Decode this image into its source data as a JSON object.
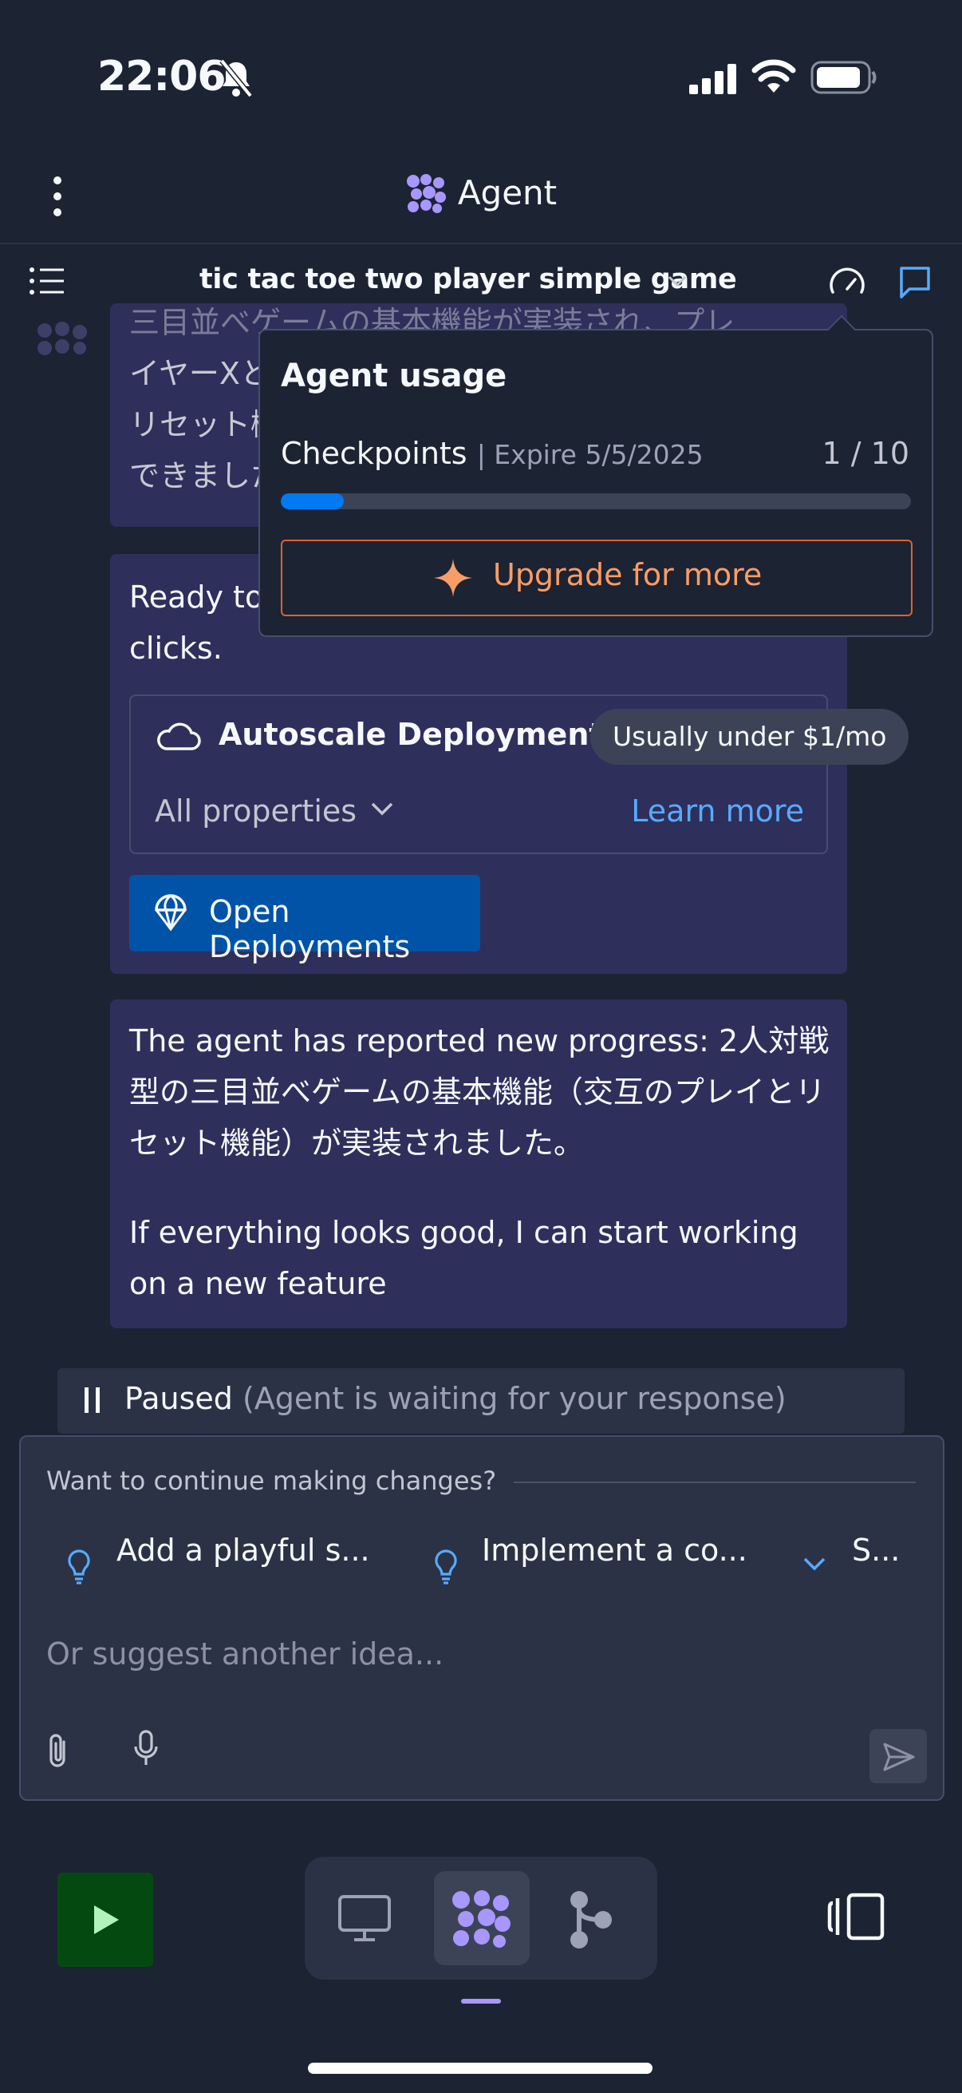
{
  "status_bar": {
    "time": "22:06"
  },
  "header": {
    "title": "Agent"
  },
  "conversation": {
    "title": "tic tac toe two player simple game"
  },
  "chat": {
    "msg1_lines": [
      "三目並べゲームの基本機能が実装され、プレ",
      "イヤーXとOの交互のプレイと",
      "リセット機能が",
      "できました"
    ],
    "deploy_message": "Ready to share? Deploy to the web in a few clicks.",
    "deploy_card": {
      "title": "Autoscale Deployment",
      "price_badge": "Usually under $1/mo",
      "properties_label": "All properties",
      "learn_more": "Learn more"
    },
    "open_deployments_label": "Open Deployments",
    "progress_message": "The agent has reported new progress: 2人対戦型の三目並べゲームの基本機能（交互のプレイとリセット機能）が実装されました。",
    "progress_followup": "If everything looks good, I can start working on a new feature"
  },
  "paused": {
    "label": "Paused",
    "detail": "(Agent is waiting for your response)"
  },
  "composer": {
    "continue_label": "Want to continue making changes?",
    "suggestions": [
      "Add a playful s...",
      "Implement a co...",
      "S..."
    ],
    "placeholder": "Or suggest another idea..."
  },
  "usage_popover": {
    "title": "Agent usage",
    "checkpoints_label": "Checkpoints",
    "checkpoints_expire": "| Expire 5/5/2025",
    "checkpoints_count": "1 / 10",
    "checkpoints_used_fraction": 0.1,
    "upgrade_label": "Upgrade for more"
  },
  "colors": {
    "accent": "#0079f2",
    "agent_purple": "#a797ff",
    "upgrade_orange": "#f99d66",
    "run_green": "#044a10"
  }
}
